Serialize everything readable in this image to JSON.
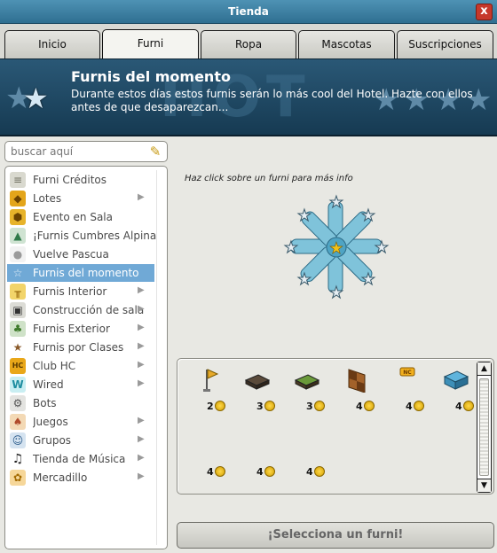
{
  "window": {
    "title": "Tienda",
    "close_label": "x"
  },
  "tabs": [
    {
      "label": "Inicio",
      "active": false
    },
    {
      "label": "Furni",
      "active": true
    },
    {
      "label": "Ropa",
      "active": false
    },
    {
      "label": "Mascotas",
      "active": false
    },
    {
      "label": "Suscripciones",
      "active": false
    }
  ],
  "banner": {
    "title": "Furnis del momento",
    "description": "Durante estos días estos furnis serán lo más cool del Hotel. Hazte con ellos antes de que desaparezcan...",
    "watermark": "HOT"
  },
  "search": {
    "placeholder": "buscar aquí"
  },
  "sidebar": {
    "items": [
      {
        "label": "Furni Créditos",
        "icon": "coins-stack-icon",
        "has_arrow": false,
        "selected": false
      },
      {
        "label": "Lotes",
        "icon": "bundle-box-icon",
        "has_arrow": true,
        "selected": false
      },
      {
        "label": "Evento en Sala",
        "icon": "event-cube-icon",
        "has_arrow": false,
        "selected": false
      },
      {
        "label": "¡Furnis Cumbres Alpina",
        "icon": "mountain-icon",
        "has_arrow": false,
        "selected": false
      },
      {
        "label": "Vuelve Pascua",
        "icon": "egg-icon",
        "has_arrow": false,
        "selected": false
      },
      {
        "label": "Furnis del momento",
        "icon": "star-icon",
        "has_arrow": false,
        "selected": true
      },
      {
        "label": "Furnis Interior",
        "icon": "table-icon",
        "has_arrow": true,
        "selected": false
      },
      {
        "label": "Construcción de sala",
        "icon": "frame-icon",
        "has_arrow": true,
        "selected": false
      },
      {
        "label": "Furnis Exterior",
        "icon": "plant-icon",
        "has_arrow": true,
        "selected": false
      },
      {
        "label": "Furnis por Clases",
        "icon": "brown-star-icon",
        "has_arrow": true,
        "selected": false
      },
      {
        "label": "Club HC",
        "icon": "hc-badge-icon",
        "has_arrow": true,
        "selected": false
      },
      {
        "label": "Wired",
        "icon": "wired-icon",
        "has_arrow": true,
        "selected": false
      },
      {
        "label": "Bots",
        "icon": "bot-icon",
        "has_arrow": false,
        "selected": false
      },
      {
        "label": "Juegos",
        "icon": "joystick-icon",
        "has_arrow": true,
        "selected": false
      },
      {
        "label": "Grupos",
        "icon": "group-icon",
        "has_arrow": true,
        "selected": false
      },
      {
        "label": "Tienda de Música",
        "icon": "music-note-icon",
        "has_arrow": true,
        "selected": false
      },
      {
        "label": "Mercadillo",
        "icon": "market-icon",
        "has_arrow": true,
        "selected": false
      }
    ]
  },
  "preview": {
    "hint": "Haz click sobre un furni para más info"
  },
  "products": [
    {
      "price": "2",
      "icon": "flag-pole-icon"
    },
    {
      "price": "3",
      "icon": "dark-bench-icon"
    },
    {
      "price": "3",
      "icon": "green-bench-icon"
    },
    {
      "price": "4",
      "icon": "checker-wall-icon"
    },
    {
      "price": "4",
      "icon": "nc-badge-icon"
    },
    {
      "price": "4",
      "icon": "blue-sofa-icon"
    },
    {
      "price": "4",
      "icon": "empty-icon"
    },
    {
      "price": "4",
      "icon": "empty-icon"
    },
    {
      "price": "4",
      "icon": "empty-icon"
    }
  ],
  "select_button": {
    "label": "¡Selecciona un furni!"
  },
  "colors": {
    "titlebar": "#3f84a8",
    "banner": "#1e4862",
    "selected_item": "#70a9d6",
    "coin": "#f2c218"
  }
}
